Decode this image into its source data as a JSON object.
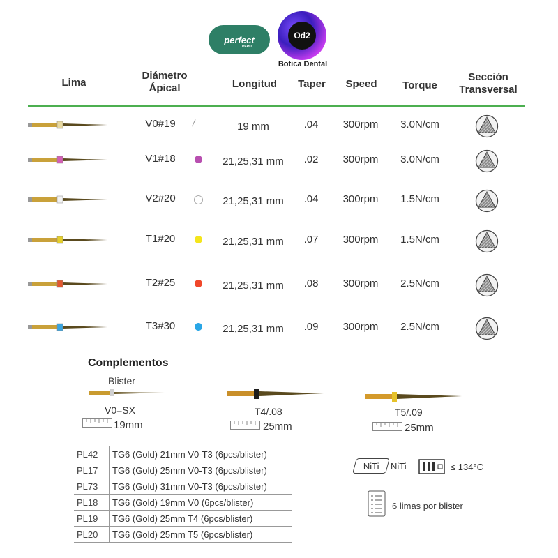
{
  "logos": {
    "perfect": {
      "name": "perfect",
      "sub": "PERU"
    },
    "od2": {
      "mark": "Od2",
      "name": "Botica Dental"
    }
  },
  "headers": {
    "lima": "Lima",
    "diametro": [
      "Diámetro",
      "Ápical"
    ],
    "longitud": "Longitud",
    "taper": "Taper",
    "speed": "Speed",
    "torque": "Torque",
    "seccion": [
      "Sección",
      "Transversal"
    ]
  },
  "rows": [
    {
      "diam": "V0#19",
      "marker": "slash",
      "color": "#999999",
      "handle": "#e8d9a0",
      "longitud": "19 mm",
      "taper": ".04",
      "speed": "300rpm",
      "torque": "3.0N/cm",
      "section_icon": "triangle-cross-section-icon"
    },
    {
      "diam": "V1#18",
      "marker": "dot",
      "color": "#b84fb0",
      "handle": "#d45fb5",
      "longitud": "21,25,31 mm",
      "taper": ".02",
      "speed": "300rpm",
      "torque": "3.0N/cm",
      "section_icon": "triangle-cross-section-icon"
    },
    {
      "diam": "V2#20",
      "marker": "ring",
      "color": "#ffffff",
      "handle": "#f2f2f2",
      "longitud": "21,25,31 mm",
      "taper": ".04",
      "speed": "300rpm",
      "torque": "1.5N/cm",
      "section_icon": "triangle-cross-section-icon"
    },
    {
      "diam": "T1#20",
      "marker": "dot",
      "color": "#f4e51c",
      "handle": "#e5cf2a",
      "longitud": "21,25,31 mm",
      "taper": ".07",
      "speed": "300rpm",
      "torque": "1.5N/cm",
      "section_icon": "triangle-cross-section-icon"
    },
    {
      "diam": "T2#25",
      "marker": "dot",
      "color": "#f0472a",
      "handle": "#e2582f",
      "longitud": "21,25,31 mm",
      "taper": ".08",
      "speed": "300rpm",
      "torque": "2.5N/cm",
      "section_icon": "triangle-cross-section-icon"
    },
    {
      "diam": "T3#30",
      "marker": "dot",
      "color": "#29a6e6",
      "handle": "#3aa5e0",
      "longitud": "21,25,31 mm",
      "taper": ".09",
      "speed": "300rpm",
      "torque": "2.5N/cm",
      "section_icon": "triangle-cross-section-icon"
    }
  ],
  "complementos": {
    "title": "Complementos",
    "blister": "Blister",
    "items": [
      {
        "name": "V0=SX",
        "length": "19mm"
      },
      {
        "name": "T4/.08",
        "length": "25mm"
      },
      {
        "name": "T5/.09",
        "length": "25mm"
      }
    ]
  },
  "products": [
    {
      "code": "PL42",
      "desc": "TG6 (Gold) 21mm V0-T3 (6pcs/blister)"
    },
    {
      "code": "PL17",
      "desc": "TG6 (Gold) 25mm V0-T3 (6pcs/blister)"
    },
    {
      "code": "PL73",
      "desc": "TG6 (Gold) 31mm V0-T3 (6pcs/blister)"
    },
    {
      "code": "PL18",
      "desc": "TG6 (Gold) 19mm V0 (6pcs/blister)"
    },
    {
      "code": "PL19",
      "desc": "TG6 (Gold) 25mm T4 (6pcs/blister)"
    },
    {
      "code": "PL20",
      "desc": "TG6 (Gold) 25mm T5 (6pcs/blister)"
    }
  ],
  "symbols": {
    "niti_badge": "NiTi",
    "niti_label": "NiTi",
    "temp": "≤ 134°C",
    "blister_label": "6 limas por blister"
  }
}
